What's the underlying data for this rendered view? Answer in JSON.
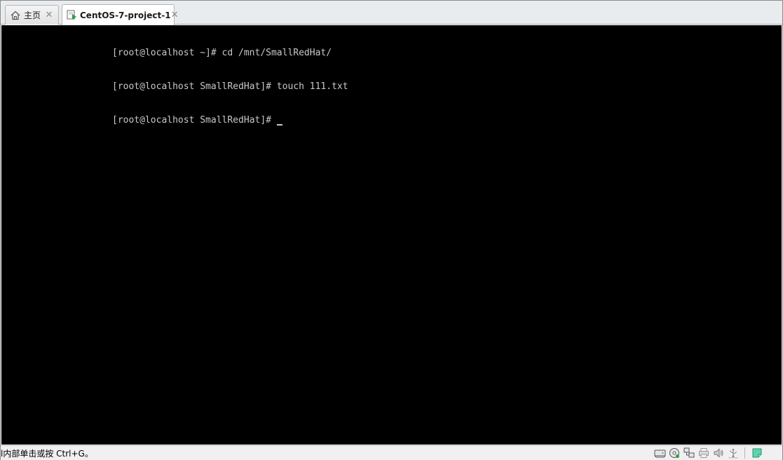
{
  "tabs": [
    {
      "label": "主页",
      "icon": "home-icon"
    },
    {
      "label": "CentOS-7-project-1",
      "icon": "vm-running-icon",
      "active": true
    }
  ],
  "console": {
    "lines": [
      "[root@localhost ~]# cd /mnt/SmallRedHat/",
      "[root@localhost SmallRedHat]# touch 111.txt",
      "[root@localhost SmallRedHat]# "
    ]
  },
  "status": {
    "text": "l内部单击或按 Ctrl+G。",
    "icons": [
      "hard-disk-icon",
      "cd-dvd-icon",
      "network-adapter-icon",
      "printer-icon",
      "sound-card-icon",
      "usb-icon",
      "message-log-icon"
    ]
  },
  "colors": {
    "console_bg": "#000000",
    "console_fg": "#c8c8c8",
    "vm_icon": "#2e9e3a"
  }
}
